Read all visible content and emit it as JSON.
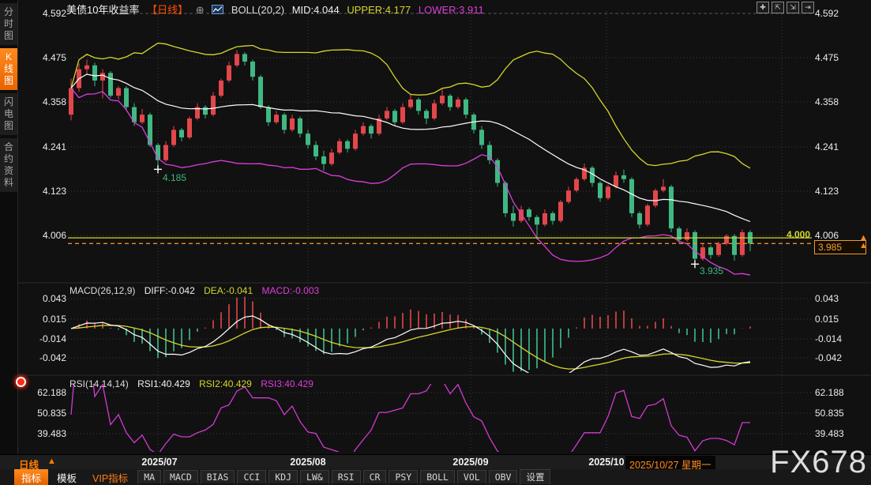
{
  "header": {
    "title": "美债10年收益率",
    "period_tag": "【日线】",
    "link_icon_glyph": "⊕",
    "boll_label": "BOLL(20,2)",
    "mid_label": "MID:4.044",
    "upper_label": "UPPER:4.177",
    "lower_label": "LOWER:3.911"
  },
  "sidebar": {
    "items": [
      {
        "key": "time-share-chart",
        "label": "分时图",
        "active": false
      },
      {
        "key": "kline-chart",
        "label": "K线图",
        "active": true
      },
      {
        "key": "lightning-chart",
        "label": "闪电图",
        "active": false
      },
      {
        "key": "contract-info",
        "label": "合约资料",
        "active": false
      }
    ]
  },
  "window_icons": [
    {
      "key": "crosshair-tool",
      "glyph": "✚"
    },
    {
      "key": "y-axis-scale",
      "glyph": "⇱"
    },
    {
      "key": "x-axis-scale",
      "glyph": "⇲"
    },
    {
      "key": "scroll-right",
      "glyph": "⇥"
    }
  ],
  "macd_panel": {
    "name": "MACD(26,12,9)",
    "diff_label": "DIFF:-0.042",
    "dea_label": "DEA:-0.041",
    "macd_label": "MACD:-0.003"
  },
  "rsi_panel": {
    "name": "RSI(14,14,14)",
    "rsi1_label": "RSI1:40.429",
    "rsi2_label": "RSI2:40.429",
    "rsi3_label": "RSI3:40.429"
  },
  "price_markers": {
    "hline_label": "4.000",
    "current_price": "3.985",
    "swing_low_1": "4.185",
    "swing_low_2": "3.935",
    "up_arrow_glyph": "▲"
  },
  "xaxis": {
    "period_label": "日线",
    "period_arrow_glyph": "▲",
    "labels": [
      "2025/07",
      "2025/08",
      "2025/09",
      "2025/10"
    ],
    "current_date": "2025/10/27 星期一"
  },
  "toolbar": {
    "tabs": [
      {
        "key": "indicators",
        "label": "指标",
        "style": "active"
      },
      {
        "key": "templates",
        "label": "模板",
        "style": "normal"
      },
      {
        "key": "vip-indicators",
        "label": "VIP指标",
        "style": "vip"
      }
    ],
    "buttons": [
      {
        "key": "ma",
        "label": "MA"
      },
      {
        "key": "macd",
        "label": "MACD"
      },
      {
        "key": "bias",
        "label": "BIAS"
      },
      {
        "key": "cci",
        "label": "CCI"
      },
      {
        "key": "kdj",
        "label": "KDJ"
      },
      {
        "key": "lw",
        "label": "LW&"
      },
      {
        "key": "rsi",
        "label": "RSI"
      },
      {
        "key": "cr",
        "label": "CR"
      },
      {
        "key": "psy",
        "label": "PSY"
      },
      {
        "key": "boll",
        "label": "BOLL"
      },
      {
        "key": "vol",
        "label": "VOL"
      },
      {
        "key": "obv",
        "label": "OBV"
      },
      {
        "key": "settings",
        "label": "设置"
      }
    ]
  },
  "watermark": "FX678",
  "colors": {
    "up": "#e2474b",
    "down": "#41b883",
    "boll_mid": "#ffffff",
    "boll_upper": "#d4d62c",
    "boll_lower": "#dd3ddd",
    "diff_line": "#ffffff",
    "dea_line": "#d4d62c",
    "rsi_line": "#d23ad2",
    "hline": "#d4d62c",
    "current_line": "#f08a20",
    "grid": "#3c3c3c",
    "accent_orange": "#ff7d00",
    "marker_green": "#3db87c"
  },
  "chart_data": {
    "type": "candlestick",
    "symbol": "美债10年收益率",
    "period": "日线",
    "main_ticks": [
      4.592,
      4.475,
      4.358,
      4.241,
      4.123,
      4.006
    ],
    "macd_ticks": [
      0.043,
      0.015,
      -0.014,
      -0.042
    ],
    "rsi_ticks": [
      62.188,
      50.835,
      39.483
    ],
    "month_labels": [
      "2025/07",
      "2025/08",
      "2025/09",
      "2025/10"
    ],
    "indicators": {
      "boll": [
        20,
        2
      ],
      "macd": [
        26,
        12,
        9
      ],
      "rsi": [
        14,
        14,
        14
      ]
    },
    "overlays": {
      "hline": 4.0,
      "current_price": 3.985
    },
    "swing_markers": [
      {
        "index": 11,
        "price": 4.185
      },
      {
        "index": 79,
        "price": 3.935
      }
    ],
    "candles": [
      [
        4.325,
        4.42,
        4.31,
        4.395
      ],
      [
        4.395,
        4.46,
        4.385,
        4.445
      ],
      [
        4.445,
        4.47,
        4.43,
        4.455
      ],
      [
        4.455,
        4.462,
        4.4,
        4.415
      ],
      [
        4.415,
        4.445,
        4.368,
        4.435
      ],
      [
        4.435,
        4.44,
        4.37,
        4.375
      ],
      [
        4.375,
        4.4,
        4.365,
        4.395
      ],
      [
        4.395,
        4.4,
        4.335,
        4.345
      ],
      [
        4.345,
        4.355,
        4.295,
        4.305
      ],
      [
        4.305,
        4.34,
        4.3,
        4.325
      ],
      [
        4.325,
        4.33,
        4.24,
        4.245
      ],
      [
        4.245,
        4.25,
        4.185,
        4.205
      ],
      [
        4.205,
        4.255,
        4.2,
        4.245
      ],
      [
        4.245,
        4.295,
        4.24,
        4.285
      ],
      [
        4.285,
        4.29,
        4.255,
        4.265
      ],
      [
        4.265,
        4.32,
        4.26,
        4.315
      ],
      [
        4.315,
        4.355,
        4.31,
        4.345
      ],
      [
        4.345,
        4.35,
        4.315,
        4.325
      ],
      [
        4.325,
        4.385,
        4.32,
        4.375
      ],
      [
        4.375,
        4.42,
        4.37,
        4.415
      ],
      [
        4.415,
        4.465,
        4.41,
        4.455
      ],
      [
        4.455,
        4.495,
        4.45,
        4.485
      ],
      [
        4.485,
        4.49,
        4.455,
        4.465
      ],
      [
        4.465,
        4.47,
        4.415,
        4.425
      ],
      [
        4.425,
        4.43,
        4.34,
        4.345
      ],
      [
        4.345,
        4.35,
        4.295,
        4.305
      ],
      [
        4.305,
        4.335,
        4.3,
        4.325
      ],
      [
        4.325,
        4.33,
        4.275,
        4.285
      ],
      [
        4.285,
        4.325,
        4.28,
        4.315
      ],
      [
        4.315,
        4.32,
        4.265,
        4.275
      ],
      [
        4.275,
        4.285,
        4.235,
        4.245
      ],
      [
        4.245,
        4.255,
        4.205,
        4.215
      ],
      [
        4.215,
        4.23,
        4.178,
        4.195
      ],
      [
        4.195,
        4.235,
        4.19,
        4.225
      ],
      [
        4.225,
        4.262,
        4.22,
        4.255
      ],
      [
        4.255,
        4.26,
        4.225,
        4.235
      ],
      [
        4.235,
        4.285,
        4.23,
        4.275
      ],
      [
        4.275,
        4.305,
        4.27,
        4.295
      ],
      [
        4.295,
        4.3,
        4.262,
        4.275
      ],
      [
        4.275,
        4.325,
        4.27,
        4.315
      ],
      [
        4.315,
        4.345,
        4.31,
        4.335
      ],
      [
        4.335,
        4.34,
        4.295,
        4.305
      ],
      [
        4.305,
        4.355,
        4.3,
        4.345
      ],
      [
        4.345,
        4.38,
        4.34,
        4.365
      ],
      [
        4.365,
        4.37,
        4.325,
        4.335
      ],
      [
        4.335,
        4.34,
        4.3,
        4.315
      ],
      [
        4.315,
        4.365,
        4.31,
        4.355
      ],
      [
        4.355,
        4.392,
        4.35,
        4.375
      ],
      [
        4.375,
        4.38,
        4.335,
        4.345
      ],
      [
        4.345,
        4.372,
        4.34,
        4.365
      ],
      [
        4.365,
        4.37,
        4.315,
        4.325
      ],
      [
        4.325,
        4.33,
        4.275,
        4.285
      ],
      [
        4.285,
        4.295,
        4.235,
        4.245
      ],
      [
        4.245,
        4.255,
        4.195,
        4.205
      ],
      [
        4.205,
        4.21,
        4.135,
        4.145
      ],
      [
        4.145,
        4.15,
        4.055,
        4.065
      ],
      [
        4.065,
        4.085,
        4.03,
        4.045
      ],
      [
        4.045,
        4.085,
        4.04,
        4.075
      ],
      [
        4.075,
        4.08,
        4.045,
        4.055
      ],
      [
        4.055,
        4.06,
        3.996,
        4.035
      ],
      [
        4.035,
        4.075,
        4.03,
        4.065
      ],
      [
        4.065,
        4.07,
        4.035,
        4.045
      ],
      [
        4.045,
        4.1,
        4.04,
        4.095
      ],
      [
        4.095,
        4.135,
        4.09,
        4.125
      ],
      [
        4.125,
        4.16,
        4.12,
        4.155
      ],
      [
        4.155,
        4.196,
        4.15,
        4.185
      ],
      [
        4.185,
        4.19,
        4.135,
        4.145
      ],
      [
        4.145,
        4.15,
        4.095,
        4.105
      ],
      [
        4.105,
        4.14,
        4.1,
        4.135
      ],
      [
        4.135,
        4.175,
        4.13,
        4.165
      ],
      [
        4.165,
        4.18,
        4.145,
        4.155
      ],
      [
        4.155,
        4.16,
        4.055,
        4.065
      ],
      [
        4.065,
        4.07,
        4.025,
        4.035
      ],
      [
        4.035,
        4.09,
        4.03,
        4.085
      ],
      [
        4.085,
        4.13,
        4.08,
        4.125
      ],
      [
        4.125,
        4.155,
        4.12,
        4.135
      ],
      [
        4.135,
        4.14,
        4.015,
        4.025
      ],
      [
        4.025,
        4.03,
        3.985,
        3.995
      ],
      [
        3.995,
        4.025,
        3.99,
        4.015
      ],
      [
        4.015,
        4.02,
        3.935,
        3.945
      ],
      [
        3.945,
        3.985,
        3.94,
        3.975
      ],
      [
        3.975,
        3.98,
        3.945,
        3.955
      ],
      [
        3.955,
        3.99,
        3.95,
        3.985
      ],
      [
        3.985,
        4.01,
        3.98,
        4.005
      ],
      [
        4.005,
        4.01,
        3.94,
        3.955
      ],
      [
        3.955,
        4.022,
        3.95,
        4.015
      ],
      [
        4.015,
        4.02,
        3.965,
        3.985
      ]
    ]
  }
}
